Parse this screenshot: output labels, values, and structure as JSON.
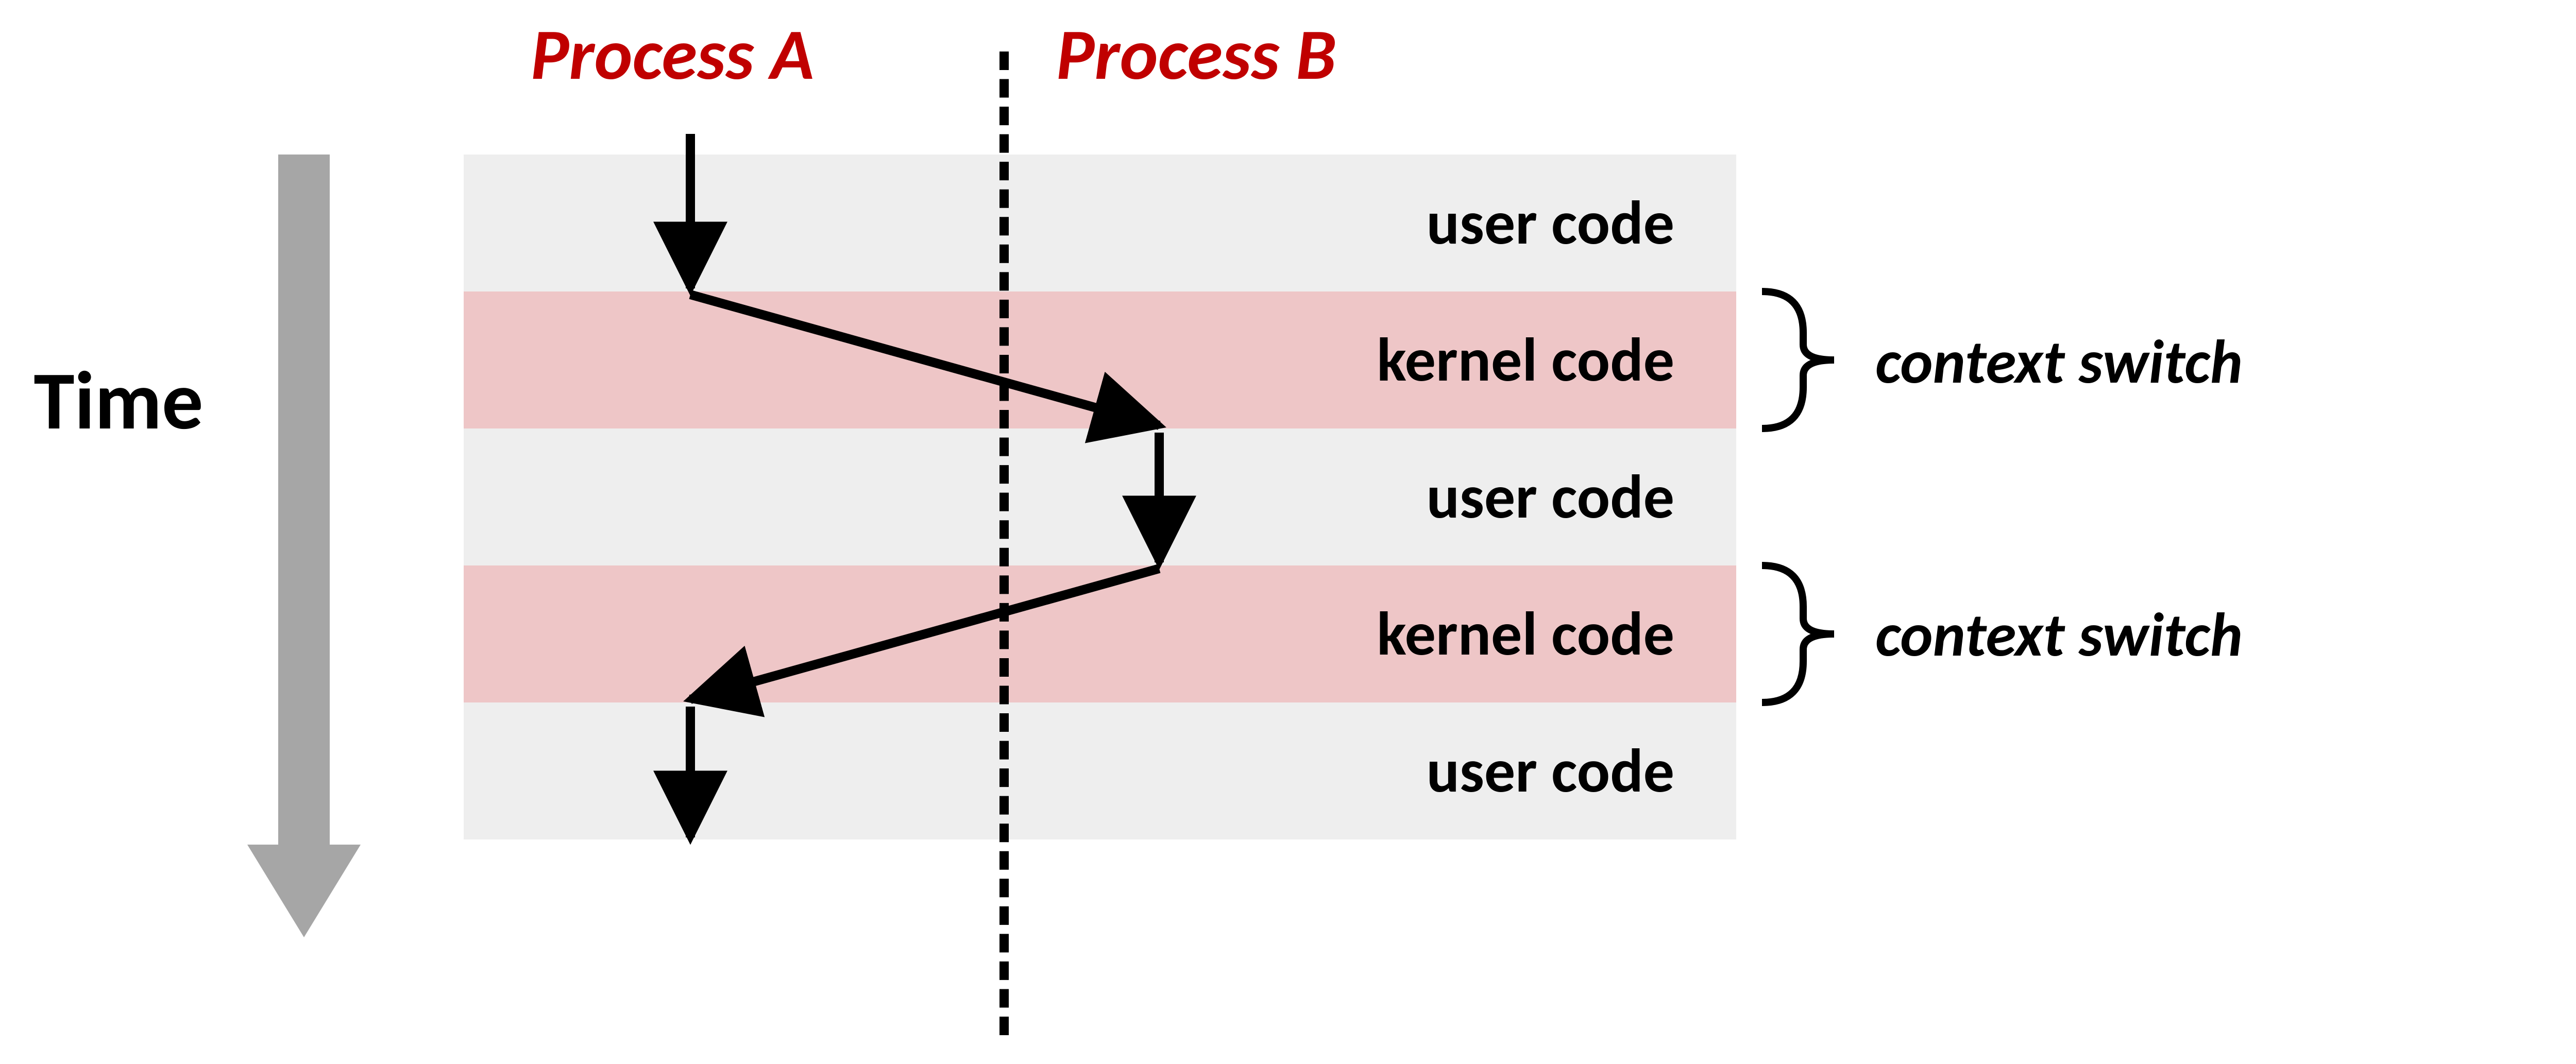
{
  "time_label": "Time",
  "process_a_label": "Process A",
  "process_b_label": "Process B",
  "bands": {
    "b0": "user code",
    "b1": "kernel code",
    "b2": "user code",
    "b3": "kernel code",
    "b4": "user code"
  },
  "context_switch_1": "context switch",
  "context_switch_2": "context switch",
  "colors": {
    "header": "#c00000",
    "user_band": "#eeeeee",
    "kernel_band": "#eec6c7",
    "arrow_gray": "#a6a6a6"
  }
}
